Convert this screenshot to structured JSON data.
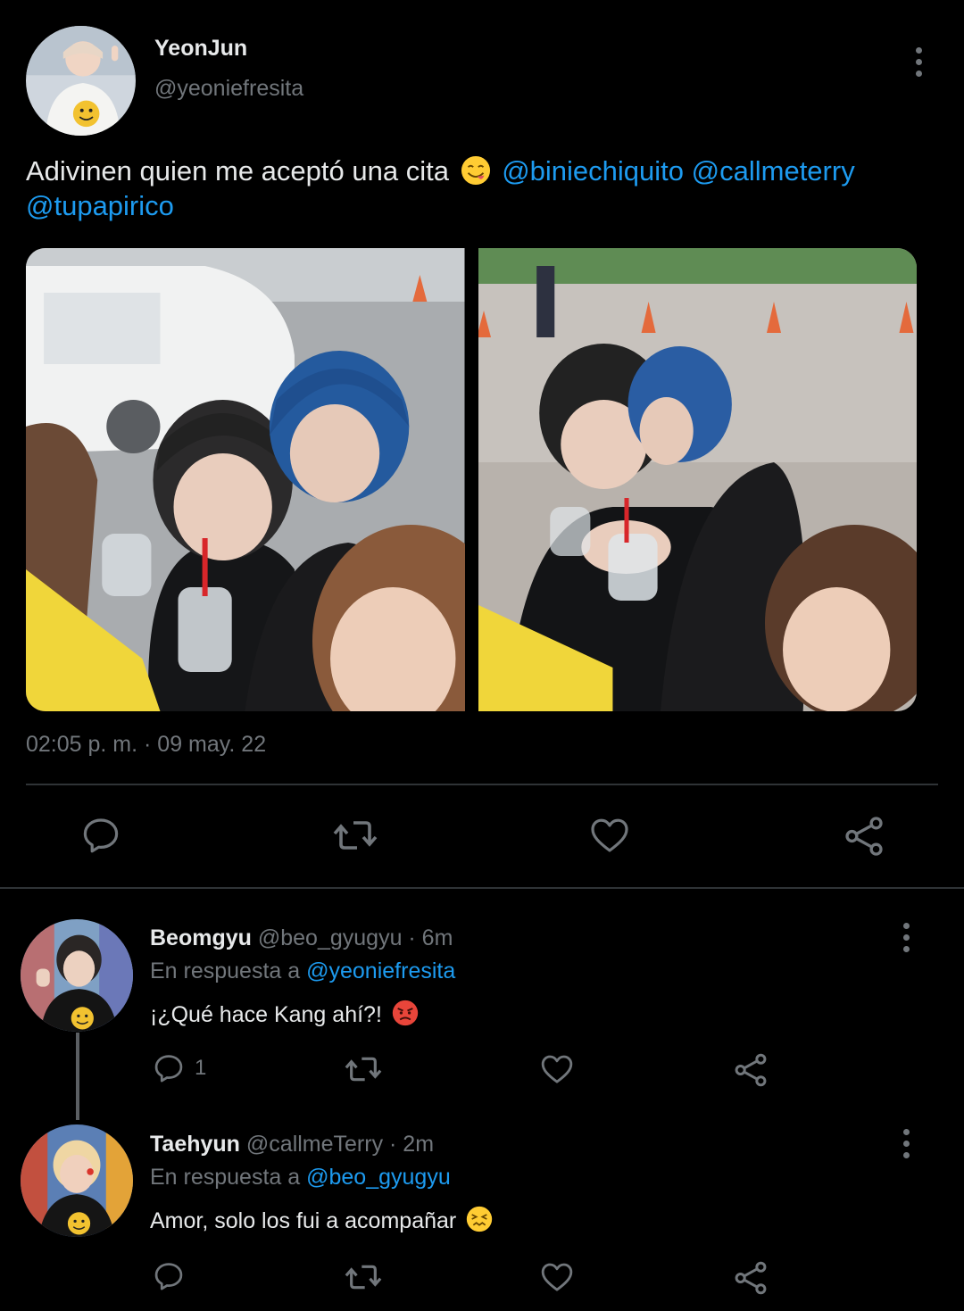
{
  "tweet": {
    "author_name": "YeonJun",
    "author_handle": "@yeoniefresita",
    "text": "Adivinen quien me aceptó una cita",
    "mentions": [
      "@biniechiquito",
      "@callmeterry",
      "@tupapirico"
    ],
    "emoji": "yum-face-emoji",
    "timestamp": "02:05 p. m. · 09 may. 22",
    "actions": {
      "reply_icon": "reply-icon",
      "retweet_icon": "retweet-icon",
      "like_icon": "heart-icon",
      "share_icon": "share-icon"
    }
  },
  "replies": [
    {
      "name": "Beomgyu",
      "handle_meta": "@beo_gyugyu · 6m",
      "in_reply_prefix": "En respuesta a",
      "in_reply_handle": "@yeoniefresita",
      "text": "¡¿Qué hace Kang ahí?!",
      "emoji": "angry-face-emoji",
      "reply_count": "1"
    },
    {
      "name": "Taehyun",
      "handle_meta": "@callmeTerry · 2m",
      "in_reply_prefix": "En respuesta a",
      "in_reply_handle": "@beo_gyugyu",
      "text": "Amor, solo los fui a acompañar",
      "emoji": "confounded-face-emoji",
      "reply_count": ""
    }
  ],
  "colors": {
    "background": "#000000",
    "text": "#e7e9ea",
    "muted": "#71767b",
    "link": "#1d9bf0",
    "divider": "#2f3336"
  }
}
